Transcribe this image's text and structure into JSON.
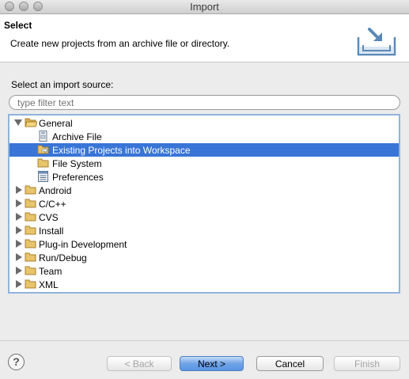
{
  "window": {
    "title": "Import"
  },
  "header": {
    "title": "Select",
    "description": "Create new projects from an archive file or directory.",
    "icon": "import-tray-icon"
  },
  "source": {
    "label": "Select an import source:",
    "filter_placeholder": "type filter text"
  },
  "tree": {
    "items": [
      {
        "label": "General",
        "icon": "folder-open-icon",
        "expanded": true,
        "level": 0
      },
      {
        "label": "Archive File",
        "icon": "archive-file-icon",
        "level": 1
      },
      {
        "label": "Existing Projects into Workspace",
        "icon": "existing-projects-icon",
        "level": 1,
        "selected": true
      },
      {
        "label": "File System",
        "icon": "folder-icon",
        "level": 1
      },
      {
        "label": "Preferences",
        "icon": "preferences-icon",
        "level": 1
      },
      {
        "label": "Android",
        "icon": "folder-icon",
        "expanded": false,
        "level": 0
      },
      {
        "label": "C/C++",
        "icon": "folder-icon",
        "expanded": false,
        "level": 0
      },
      {
        "label": "CVS",
        "icon": "folder-icon",
        "expanded": false,
        "level": 0
      },
      {
        "label": "Install",
        "icon": "folder-icon",
        "expanded": false,
        "level": 0
      },
      {
        "label": "Plug-in Development",
        "icon": "folder-icon",
        "expanded": false,
        "level": 0
      },
      {
        "label": "Run/Debug",
        "icon": "folder-icon",
        "expanded": false,
        "level": 0
      },
      {
        "label": "Team",
        "icon": "folder-icon",
        "expanded": false,
        "level": 0
      },
      {
        "label": "XML",
        "icon": "folder-icon",
        "expanded": false,
        "level": 0
      }
    ]
  },
  "buttons": {
    "help": "?",
    "back": "< Back",
    "next": "Next >",
    "cancel": "Cancel",
    "finish": "Finish"
  },
  "colors": {
    "selection": "#3875d7",
    "tree_border": "#8fb3dc",
    "folder": "#e8c46a"
  }
}
